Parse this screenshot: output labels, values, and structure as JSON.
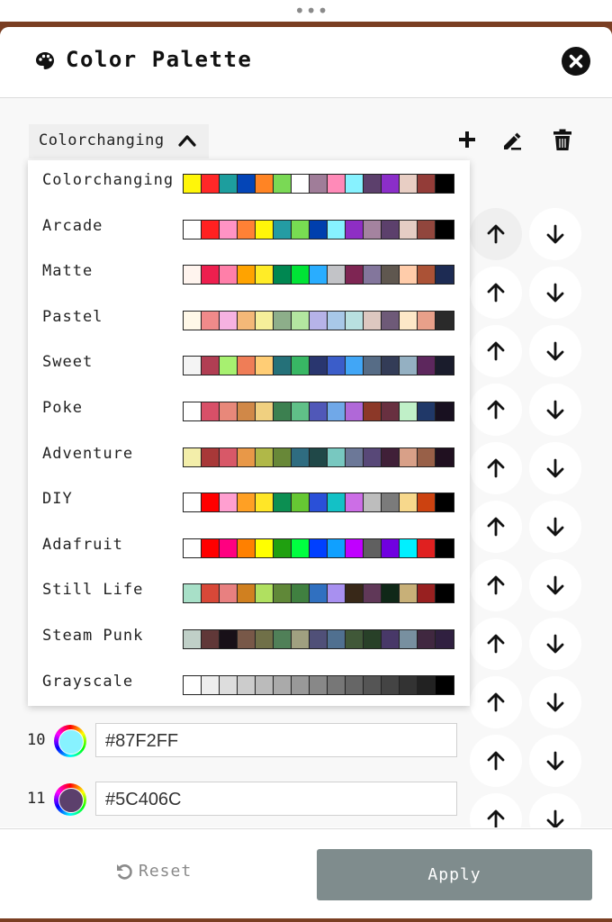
{
  "app": {
    "title": "Color Palette"
  },
  "toolbar": {
    "dropdown_label": "Colorchanging"
  },
  "palettes": [
    {
      "name": "Colorchanging",
      "colors": [
        "#fff609",
        "#ff2828",
        "#1d9e9e",
        "#0445b7",
        "#ff8424",
        "#7ad955",
        "#ffffff",
        "#a07d99",
        "#ff8ab8",
        "#87f2ff",
        "#5c406c",
        "#8b2ec9",
        "#e8cec4",
        "#933c38",
        "#000000"
      ]
    },
    {
      "name": "Arcade",
      "colors": [
        "#ffffff",
        "#ff2121",
        "#ff93c4",
        "#ff8135",
        "#fff609",
        "#249ca3",
        "#78dc52",
        "#003fad",
        "#87f2ff",
        "#8e2ec4",
        "#a4839f",
        "#5c406c",
        "#e5cdc4",
        "#91463d",
        "#000000"
      ]
    },
    {
      "name": "Matte",
      "colors": [
        "#fff4ee",
        "#ed1f4e",
        "#ff7fa9",
        "#ffa300",
        "#ffec27",
        "#008751",
        "#00e436",
        "#29adff",
        "#c2c3c7",
        "#7e2553",
        "#83769c",
        "#5f574f",
        "#ffccaa",
        "#ab5236",
        "#1d2b53"
      ]
    },
    {
      "name": "Pastel",
      "colors": [
        "#fff8e8",
        "#f08a8a",
        "#f6b2e1",
        "#f4b878",
        "#f6ef9a",
        "#8dae8a",
        "#b3e6a0",
        "#b6b3e8",
        "#a8c8e8",
        "#b8e0e0",
        "#ddc8c0",
        "#6e5a78",
        "#fde8c8",
        "#e8a08a",
        "#2a2a2a"
      ]
    },
    {
      "name": "Sweet",
      "colors": [
        "#f4f4f4",
        "#b13e53",
        "#a7f070",
        "#ef7d57",
        "#ffcd75",
        "#257179",
        "#38b764",
        "#29366f",
        "#3b5dc9",
        "#41a6f6",
        "#566c86",
        "#333c57",
        "#94b0c2",
        "#5d275d",
        "#1a1c2c"
      ]
    },
    {
      "name": "Poke",
      "colors": [
        "#ffffff",
        "#d85068",
        "#e8887a",
        "#d08848",
        "#f0d080",
        "#3c8050",
        "#60c088",
        "#5058b8",
        "#70a8e8",
        "#b068d8",
        "#8c3828",
        "#683040",
        "#c0f0c8",
        "#203868",
        "#181020"
      ]
    },
    {
      "name": "Adventure",
      "colors": [
        "#f3eeaa",
        "#a83838",
        "#d85868",
        "#e89848",
        "#b0b848",
        "#688838",
        "#2f6c80",
        "#204848",
        "#78c8c0",
        "#6c7898",
        "#584878",
        "#402038",
        "#d8a088",
        "#986048",
        "#201020"
      ]
    },
    {
      "name": "DIY",
      "colors": [
        "#ffffff",
        "#ff0000",
        "#ff9fd0",
        "#ffa024",
        "#ffe627",
        "#0c8f52",
        "#66c733",
        "#2a50d8",
        "#13c1c6",
        "#cc6ee6",
        "#bdbdbd",
        "#7b7b7b",
        "#f7d88c",
        "#cc4210",
        "#000000"
      ]
    },
    {
      "name": "Adafruit",
      "colors": [
        "#ffffff",
        "#ff0000",
        "#ff0080",
        "#ff8000",
        "#ffff00",
        "#20a010",
        "#00ff40",
        "#0040ff",
        "#10a0ff",
        "#c000ff",
        "#606060",
        "#7000e0",
        "#00f0ff",
        "#e02020",
        "#000000"
      ]
    },
    {
      "name": "Still Life",
      "colors": [
        "#a8e0c8",
        "#d84838",
        "#e88080",
        "#d08020",
        "#b0e060",
        "#608838",
        "#408040",
        "#3070c0",
        "#a890f0",
        "#382818",
        "#603858",
        "#102818",
        "#c8b078",
        "#982020",
        "#000000"
      ]
    },
    {
      "name": "Steam Punk",
      "colors": [
        "#c0d0c8",
        "#603838",
        "#181018",
        "#785848",
        "#707048",
        "#508058",
        "#a0a080",
        "#505078",
        "#507090",
        "#405838",
        "#284028",
        "#483868",
        "#7890a0",
        "#402840",
        "#302040"
      ]
    },
    {
      "name": "Grayscale",
      "colors": [
        "#ffffff",
        "#eeeeee",
        "#dddddd",
        "#cccccc",
        "#bbbbbb",
        "#aaaaaa",
        "#999999",
        "#888888",
        "#777777",
        "#666666",
        "#555555",
        "#444444",
        "#333333",
        "#222222",
        "#000000"
      ]
    }
  ],
  "rows": [
    {
      "index": "10",
      "hex": "#87F2FF",
      "swatch": "#87f2ff"
    },
    {
      "index": "11",
      "hex": "#5C406C",
      "swatch": "#5c406c"
    }
  ],
  "footer": {
    "reset_label": "Reset",
    "apply_label": "Apply"
  },
  "colors": {
    "accent": "#111111",
    "apply_bg": "#7f8c8d",
    "panel_bg": "#f8f8f8",
    "outer_bg": "#7a3e22"
  },
  "icons": [
    "palette-icon",
    "close-icon",
    "chevron-up-icon",
    "plus-icon",
    "edit-icon",
    "trash-icon",
    "arrow-up-icon",
    "arrow-down-icon",
    "undo-icon"
  ]
}
